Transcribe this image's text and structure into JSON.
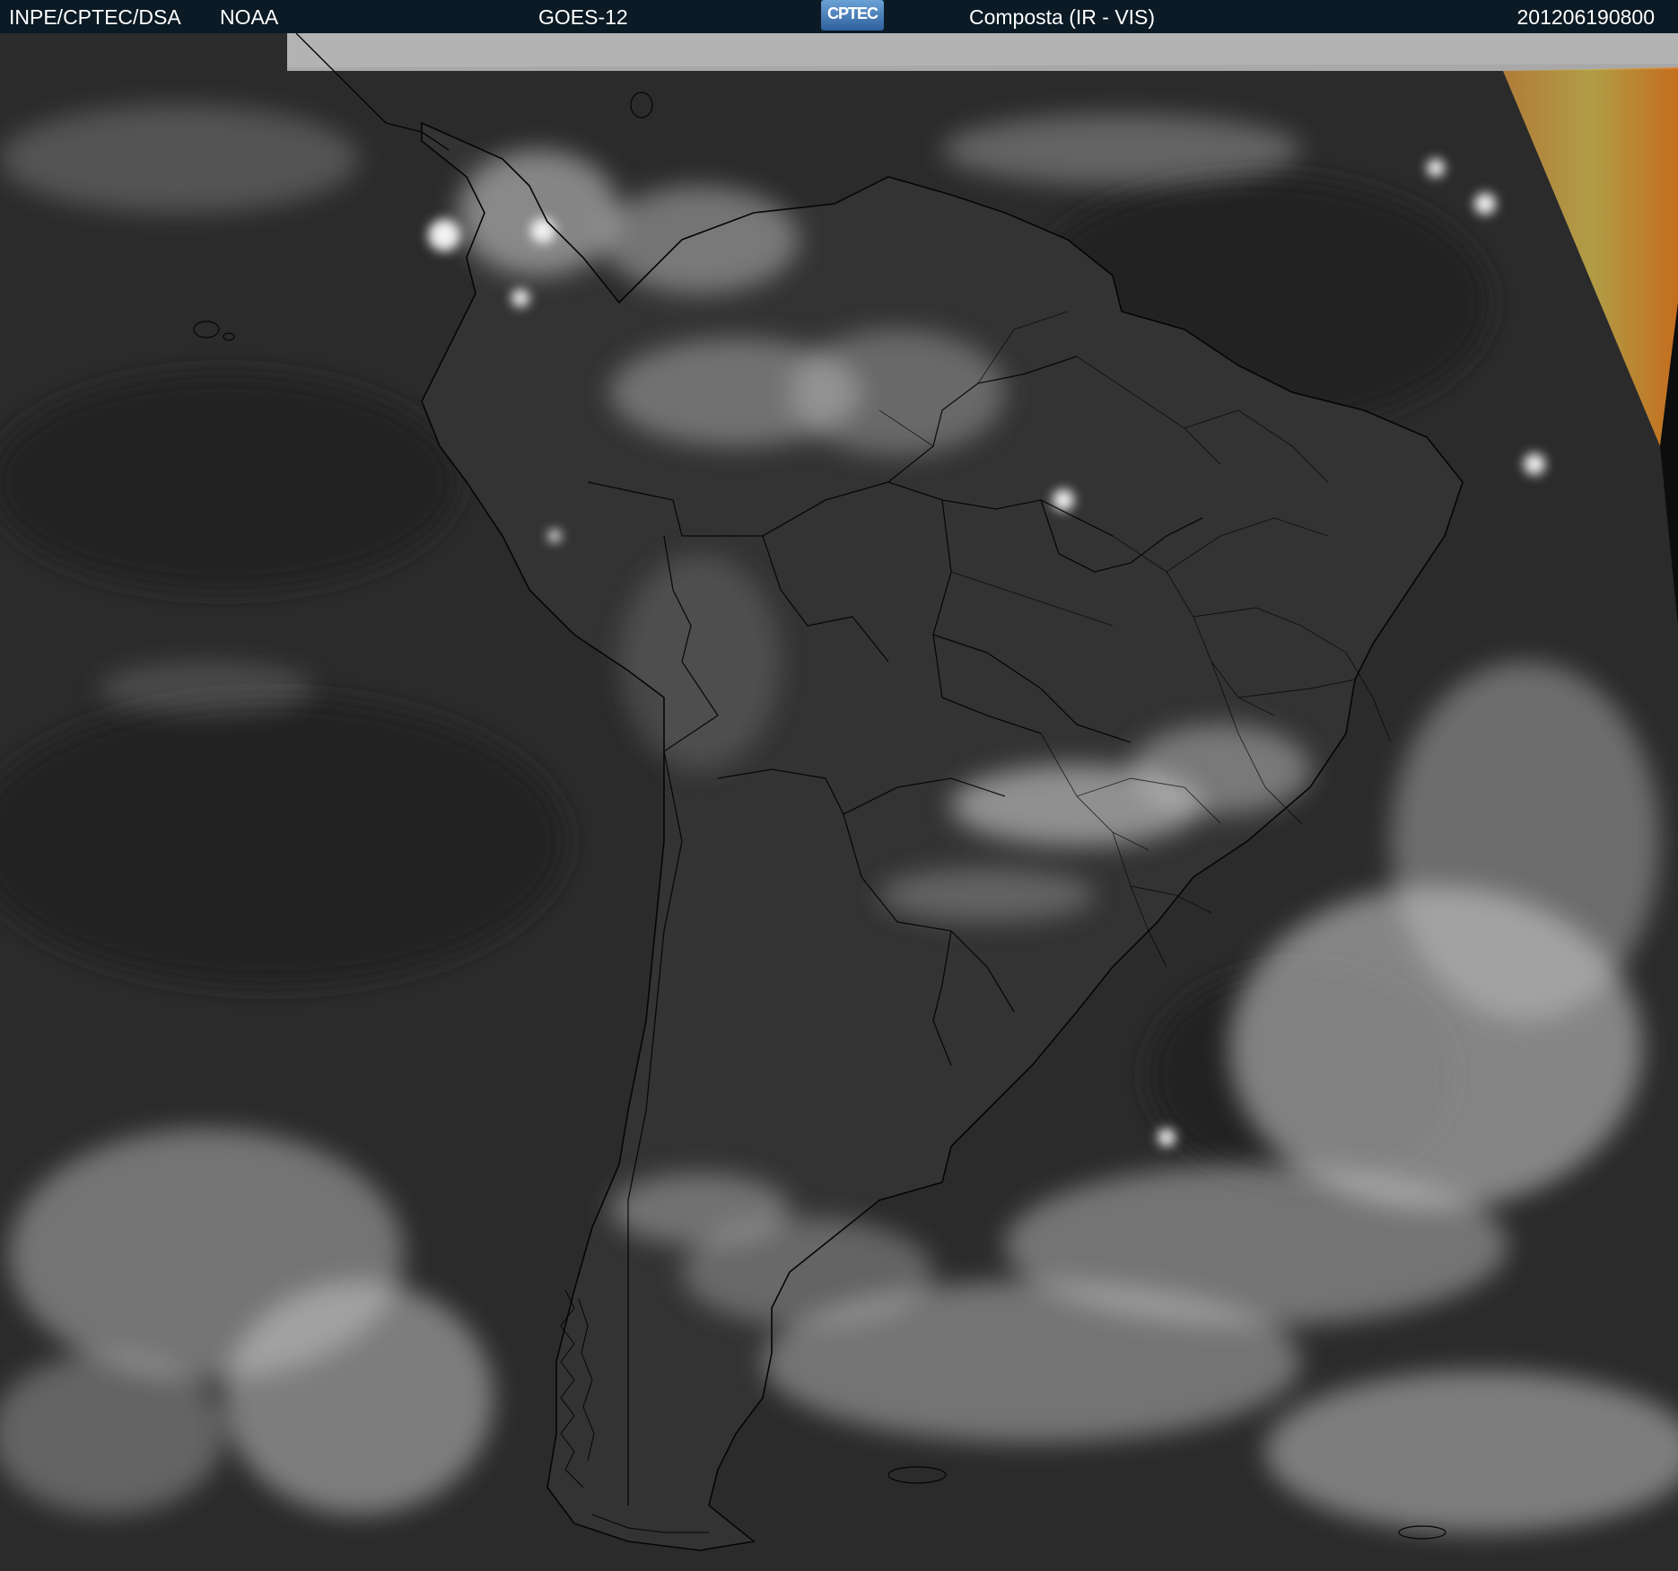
{
  "header": {
    "organization": "INPE/CPTEC/DSA",
    "agency": "NOAA",
    "satellite": "GOES-12",
    "logo_text": "CPTEC",
    "product": "Composta (IR - VIS)",
    "timestamp": "201206190800"
  },
  "colors": {
    "header_background": "#0b1a24",
    "header_text": "#ffffff",
    "ocean": "#2b2b2b",
    "land": "#333333",
    "cloud": "#d8d8d8",
    "no_data_band": "#aaaaaa",
    "borders": "#000000",
    "false_color_strip": "#d4a34a"
  },
  "map": {
    "region": "South America",
    "imagery": "satellite composite, infrared and visible",
    "coastlines": true,
    "country_borders": true,
    "state_borders": true
  }
}
